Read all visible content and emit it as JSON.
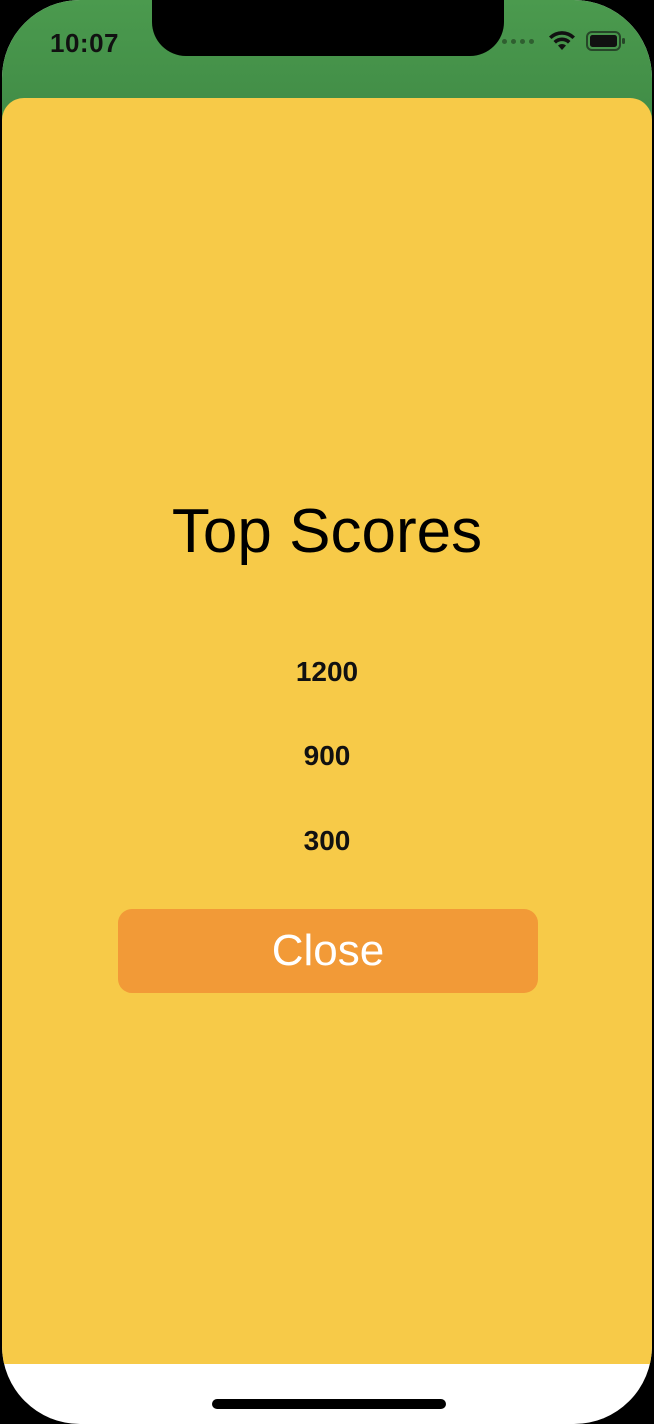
{
  "status_bar": {
    "time": "10:07",
    "icons": [
      "cellular-signal-icon",
      "wifi-icon",
      "battery-icon"
    ]
  },
  "screen": {
    "title": "Top Scores",
    "scores": [
      "1200",
      "900",
      "300"
    ],
    "close_label": "Close"
  },
  "colors": {
    "header_green": "#3f8a45",
    "sheet_yellow": "#f7ca48",
    "button_orange": "#f29a37",
    "button_text": "#ffffff"
  }
}
